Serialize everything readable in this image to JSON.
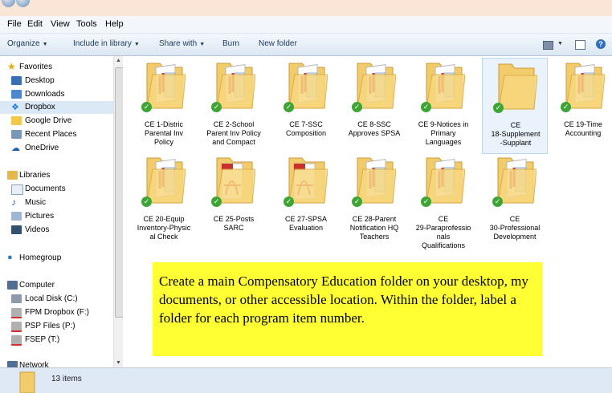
{
  "menu": [
    "File",
    "Edit",
    "View",
    "Tools",
    "Help"
  ],
  "toolbar": {
    "organize": "Organize",
    "include": "Include in library",
    "share": "Share with",
    "burn": "Burn",
    "new_folder": "New folder"
  },
  "sidebar": {
    "favorites": "Favorites",
    "fav_items": [
      "Desktop",
      "Downloads",
      "Dropbox",
      "Google Drive",
      "Recent Places",
      "OneDrive"
    ],
    "selected": "Dropbox",
    "libraries": "Libraries",
    "lib_items": [
      "Documents",
      "Music",
      "Pictures",
      "Videos"
    ],
    "homegroup": "Homegroup",
    "computer": "Computer",
    "drives": [
      "Local Disk (C:)",
      "FPM Dropbox (F:)",
      "PSP Files (P:)",
      "FSEP (T:)"
    ],
    "network": "Network"
  },
  "files": [
    {
      "label": "CE 1-Distric\nParental Inv\nPolicy",
      "kind": "folder-docs",
      "synced": true
    },
    {
      "label": "CE 2-School\nParent Inv Policy\nand Compact",
      "kind": "folder-docs",
      "synced": true
    },
    {
      "label": "CE 7-SSC\nComposition",
      "kind": "folder-docs",
      "synced": true
    },
    {
      "label": "CE 8-SSC\nApproves SPSA",
      "kind": "folder-docs",
      "synced": true
    },
    {
      "label": "CE 9-Notices in\nPrimary\nLanguages",
      "kind": "folder-docs",
      "synced": true
    },
    {
      "label": "CE\n18-Supplement\n-Supplant",
      "kind": "folder-empty",
      "synced": true,
      "selected": true
    },
    {
      "label": "CE 19-Time\nAccounting",
      "kind": "folder-docs",
      "synced": true
    },
    {
      "label": "CE 20-Equip\nInventory-Physic\nal Check",
      "kind": "folder-docs",
      "synced": true
    },
    {
      "label": "CE 25-Posts\nSARC",
      "kind": "folder-pdf",
      "synced": true
    },
    {
      "label": "CE 27-SPSA\nEvaluation",
      "kind": "folder-pdf",
      "synced": true
    },
    {
      "label": "CE 28-Parent\nNotification HQ\nTeachers",
      "kind": "folder-docs",
      "synced": true
    },
    {
      "label": "CE\n29-Paraprofessio\nnals\nQualifications",
      "kind": "folder-docs",
      "synced": true
    },
    {
      "label": "CE\n30-Professional\nDevelopment",
      "kind": "folder-docs",
      "synced": true
    }
  ],
  "note": "Create a main Compensatory Education folder on your desktop, my documents, or other accessible location. Within the folder, label a folder for each program item number.",
  "status": {
    "count": "13 items"
  },
  "colors": {
    "folder": "#f2cc6a",
    "check": "#3ea535",
    "note_bg": "#ffff33",
    "pdf_red": "#c9302c"
  }
}
